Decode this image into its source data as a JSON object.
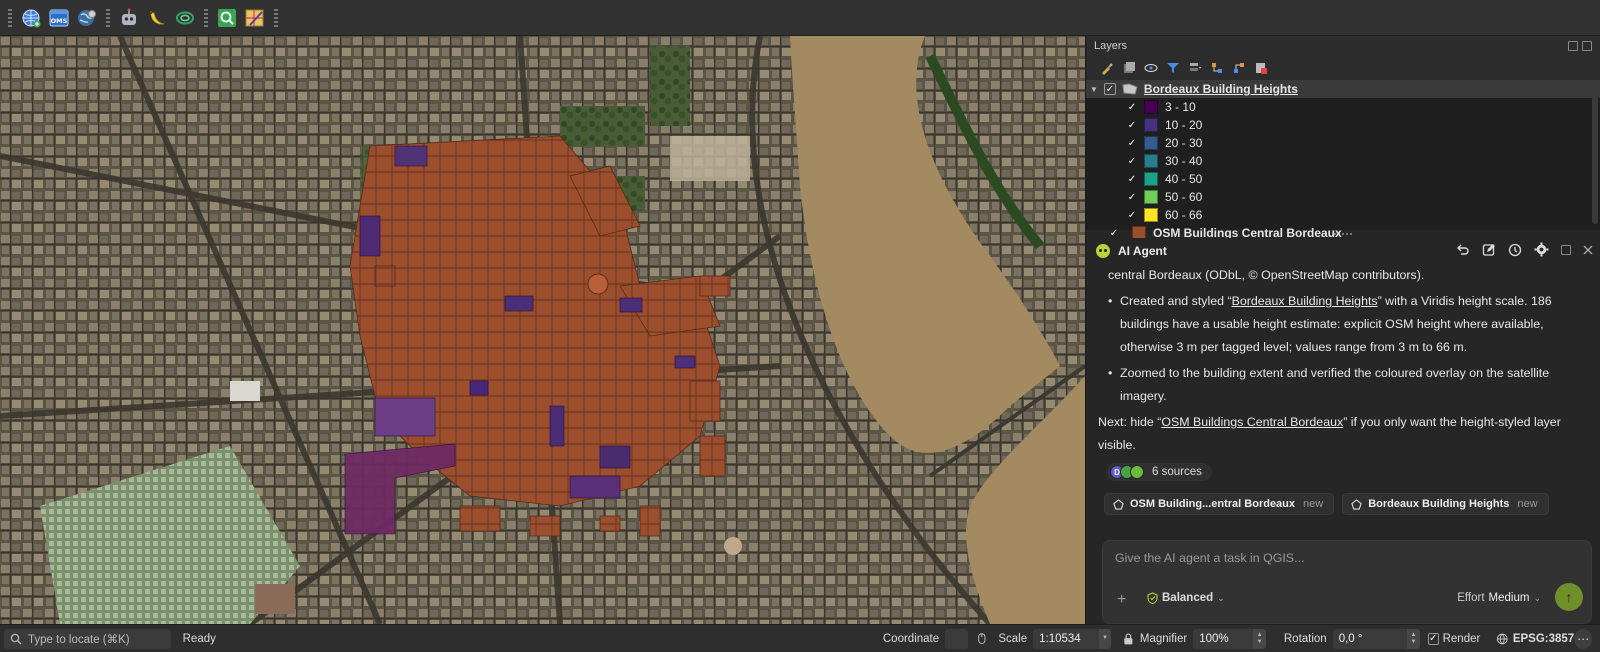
{
  "toolbar": {
    "icons": [
      "globe-add-icon",
      "oms-icon",
      "world-gear-icon",
      "robot-icon",
      "banana-icon",
      "swirl-icon",
      "locate-search-icon",
      "map-wand-icon"
    ],
    "oms_label": "OMS"
  },
  "layers_panel": {
    "title": "Layers",
    "groups": [
      {
        "name": "Bordeaux Building Heights",
        "checked": true,
        "classes": [
          {
            "label": "3 - 10",
            "color": "#440154"
          },
          {
            "label": "10 - 20",
            "color": "#46327e"
          },
          {
            "label": "20 - 30",
            "color": "#365c8d"
          },
          {
            "label": "30 - 40",
            "color": "#277f8e"
          },
          {
            "label": "40 - 50",
            "color": "#1fa187"
          },
          {
            "label": "50 - 60",
            "color": "#6ece58"
          },
          {
            "label": "60 - 66",
            "color": "#fde725"
          }
        ]
      },
      {
        "name": "OSM Buildings Central Bordeaux",
        "checked": true,
        "color": "#9a4e2c"
      }
    ]
  },
  "agent": {
    "title": "AI Agent",
    "message": {
      "intro": "central Bordeaux (ODbL, © OpenStreetMap contributors).",
      "bullet1_pre": "Created and styled “",
      "bullet1_link": "Bordeaux Building Heights",
      "bullet1_post": "” with a Viridis height scale. 186 buildings have a usable height estimate: explicit OSM height where available, otherwise 3 m per tagged level; values range from 3 m to 66 m.",
      "bullet2": "Zoomed to the building extent and verified the coloured overlay on the satellite imagery.",
      "next_pre": "Next: hide “",
      "next_link": "OSM Buildings Central Bordeaux",
      "next_post": "” if you only want the height-styled layer visible."
    },
    "sources": {
      "label": "6 sources",
      "initial": "D"
    },
    "chips": [
      {
        "label": "OSM Building...entral Bordeaux",
        "badge": "new"
      },
      {
        "label": "Bordeaux Building Heights",
        "badge": "new"
      }
    ],
    "prompt": {
      "placeholder": "Give the AI agent a task in QGIS...",
      "mode": "Balanced",
      "effort_label": "Effort",
      "effort_value": "Medium"
    }
  },
  "status_bar": {
    "locate_placeholder": "Type to locate (⌘K)",
    "ready": "Ready",
    "coordinate_label": "Coordinate",
    "coordinate_value": "",
    "scale_label": "Scale",
    "scale_value": "1:10534",
    "magnifier_label": "Magnifier",
    "magnifier_value": "100%",
    "rotation_label": "Rotation",
    "rotation_value": "0,0 °",
    "render_label": "Render",
    "render_checked": true,
    "crs": "EPSG:3857"
  }
}
